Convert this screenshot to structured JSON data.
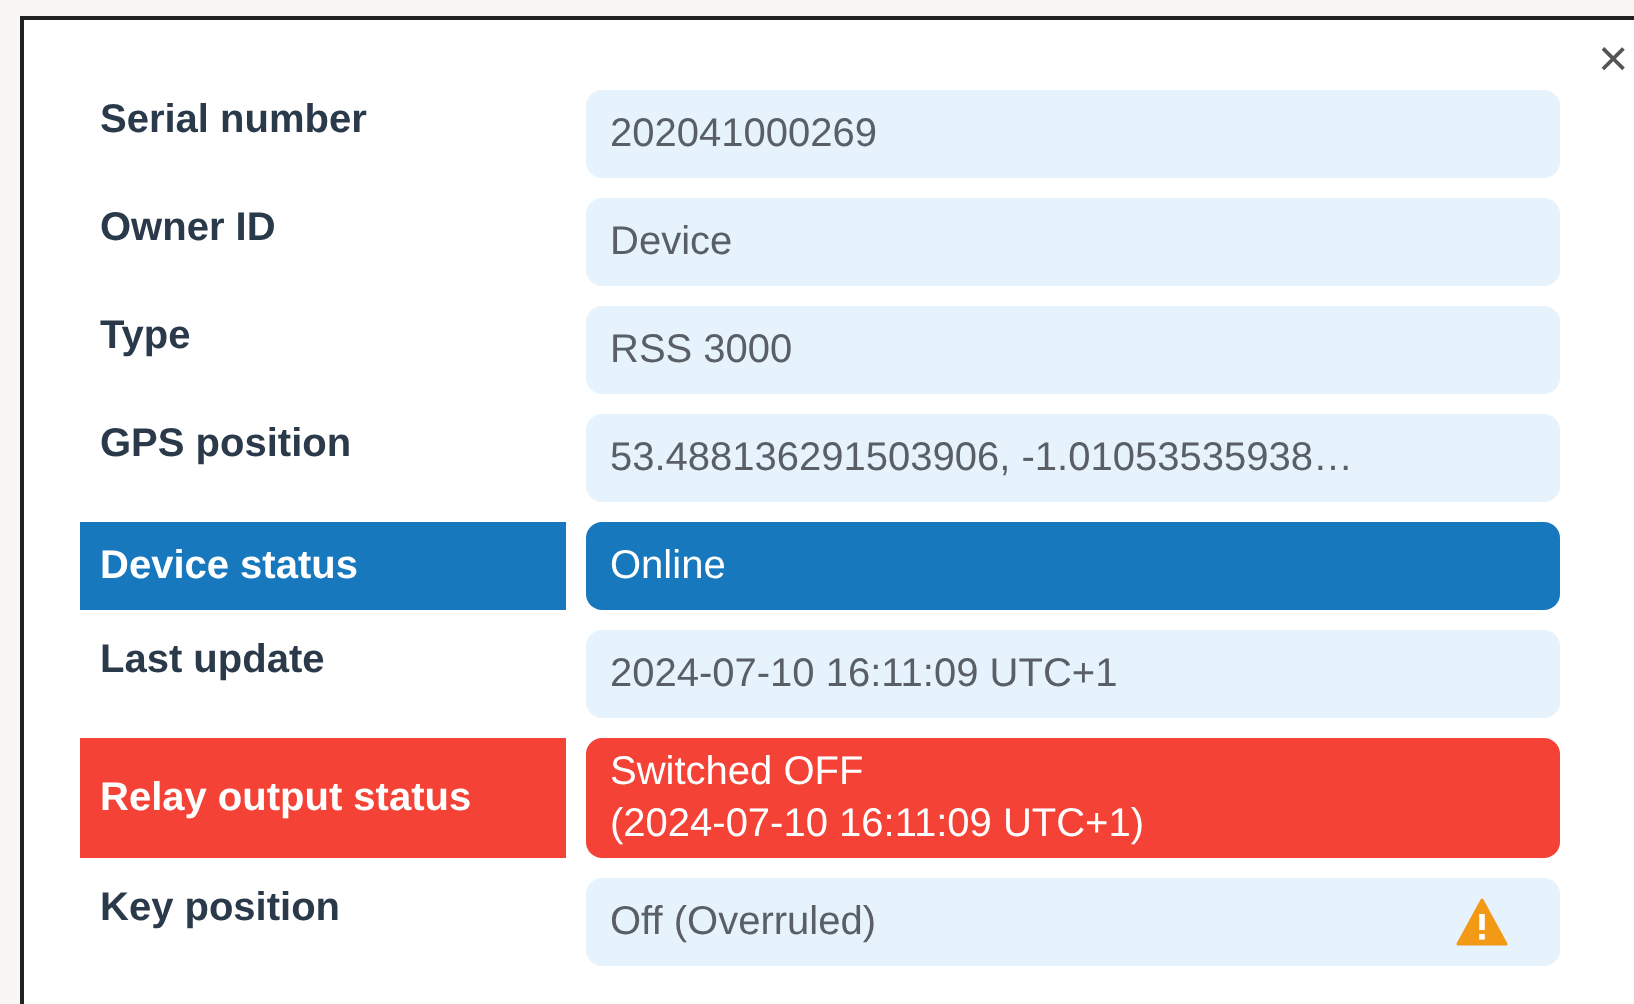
{
  "dialog": {
    "close_label": "×",
    "rows": [
      {
        "label": "Serial number",
        "value": "202041000269",
        "kind": "normal",
        "warning": false
      },
      {
        "label": "Owner ID",
        "value": "Device",
        "kind": "normal",
        "warning": false
      },
      {
        "label": "Type",
        "value": "RSS 3000",
        "kind": "normal",
        "warning": false
      },
      {
        "label": "GPS position",
        "value": "53.488136291503906, -1.01053535938…",
        "kind": "normal",
        "warning": false
      },
      {
        "label": "Device status",
        "value": "Online",
        "kind": "online",
        "warning": false
      },
      {
        "label": "Last update",
        "value": "2024-07-10 16:11:09 UTC+1",
        "kind": "normal",
        "warning": false
      },
      {
        "label": "Relay output status",
        "value": "Switched OFF\n(2024-07-10 16:11:09 UTC+1)",
        "kind": "alert",
        "warning": false
      },
      {
        "label": "Key position",
        "value": "Off (Overruled)",
        "kind": "normal",
        "warning": true
      }
    ]
  }
}
